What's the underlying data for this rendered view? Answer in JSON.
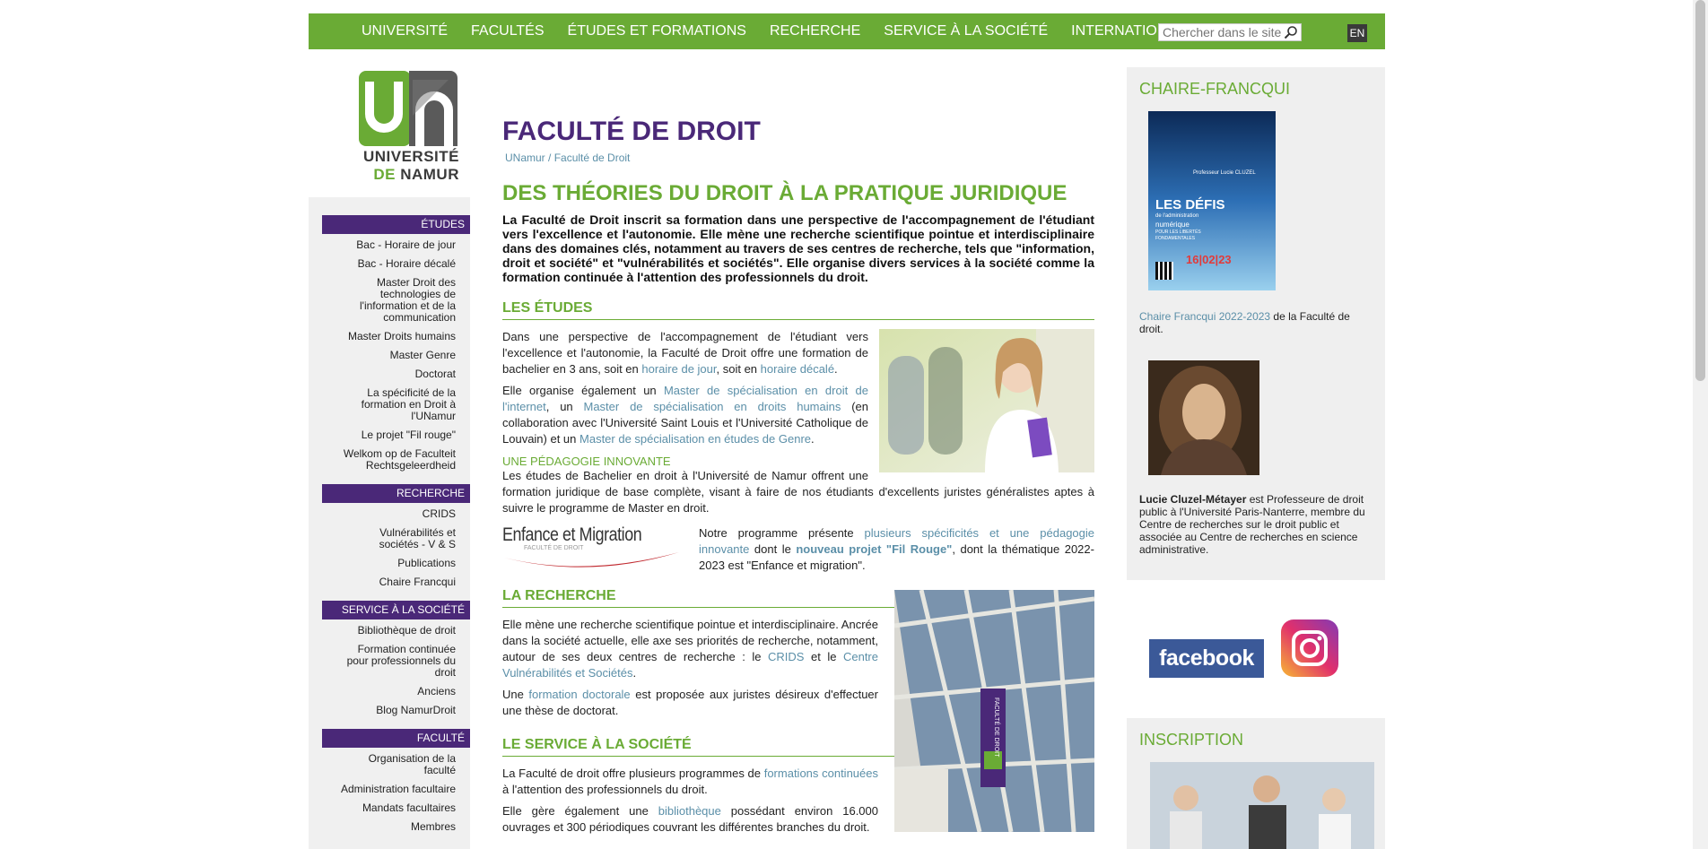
{
  "nav": {
    "items": [
      "UNIVERSITÉ",
      "FACULTÉS",
      "ÉTUDES ET FORMATIONS",
      "RECHERCHE",
      "SERVICE À LA SOCIÉTÉ",
      "INTERNATIONAL"
    ],
    "search_placeholder": "Chercher dans le site",
    "lang": "EN"
  },
  "logo": {
    "line1": "UNIVERSITÉ",
    "line2a": "DE",
    "line2b": "NAMUR"
  },
  "sidebar": {
    "etudes": {
      "title": "ÉTUDES",
      "items": [
        "Bac - Horaire de jour",
        "Bac - Horaire décalé",
        "Master Droit des technologies de l'information et de la communication",
        "Master Droits humains",
        "Master Genre",
        "Doctorat",
        "La spécificité de la formation en Droit à l'UNamur",
        "Le projet \"Fil rouge\"",
        "Welkom op de Faculteit Rechtsgeleerdheid"
      ]
    },
    "recherche": {
      "title": "RECHERCHE",
      "items": [
        "CRIDS",
        "Vulnérabilités et sociétés - V & S",
        "Publications",
        "Chaire Francqui"
      ]
    },
    "service": {
      "title": "SERVICE À LA SOCIÉTÉ",
      "items": [
        "Bibliothèque de droit",
        "Formation continuée pour professionnels du droit",
        "Anciens",
        "Blog NamurDroit"
      ]
    },
    "faculte": {
      "title": "FACULTÉ",
      "items": [
        "Organisation de la faculté",
        "Administration facultaire",
        "Mandats facultaires",
        "Membres"
      ]
    }
  },
  "main": {
    "title": "FACULTÉ DE DROIT",
    "breadcrumb": {
      "home": "UNamur",
      "sep": " / ",
      "current": "Faculté de Droit"
    },
    "headline": "DES THÉORIES DU DROIT À LA PRATIQUE JURIDIQUE",
    "intro": "La Faculté de Droit inscrit sa formation dans une perspective de l'accompagnement de l'étudiant vers l'excellence et l'autonomie. Elle mène une recherche scientifique pointue et interdisciplinaire dans des domaines clés, notamment au travers de ses centres de recherche, tels que \"information, droit et société\" et \"vulnérabilités et sociétés\". Elle organise divers services à la société comme la formation continuée à l'attention des professionnels du droit.",
    "etudes": {
      "title": "LES ÉTUDES",
      "p1a": "Dans une perspective de l'accompagnement de l'étudiant vers l'excellence et l'autonomie, la Faculté de Droit offre une formation de bachelier en 3 ans, soit en ",
      "p1_link1": "horaire de jour",
      "p1b": ", soit en ",
      "p1_link2": "horaire décalé",
      "p1c": ".",
      "p2a": "Elle organise également un ",
      "p2_link1": "Master de spécialisation en droit de l'internet",
      "p2b": ", un ",
      "p2_link2": "Master de spécialisation en droits humains",
      "p2c": " (en collaboration avec l'Université Saint Louis et l'Université Catholique de Louvain) et un ",
      "p2_link3": "Master de spécialisation en études de Genre",
      "p2d": ".",
      "sub": "UNE PÉDAGOGIE INNOVANTE",
      "p3": "Les études de Bachelier en droit à l'Université de Namur offrent une formation juridique de base complète, visant à faire de nos étudiants d'excellents juristes généralistes aptes à suivre le programme de Master en droit.",
      "em_logo": "Enfance et Migration",
      "em_sub": "FACULTÉ DE DROIT",
      "p4a": "Notre programme présente ",
      "p4_link1": "plusieurs spécificités et une pédagogie innovante",
      "p4b": " dont le ",
      "p4_link2": "nouveau projet \"Fil Rouge\"",
      "p4c": ", dont la thématique 2022-2023 est \"Enfance et migration\"."
    },
    "recherche": {
      "title": "LA RECHERCHE",
      "p1a": "Elle mène une recherche scientifique pointue et interdisciplinaire. Ancrée dans la société actuelle, elle axe ses priorités de recherche, notamment, autour de ses deux centres de recherche : le ",
      "p1_link1": "CRIDS",
      "p1b": " et le ",
      "p1_link2": "Centre Vulnérabilités et Sociétés",
      "p1c": ".",
      "p2a": "Une ",
      "p2_link": "formation doctorale",
      "p2b": " est proposée aux juristes désireux d'effectuer une thèse de doctorat.",
      "banner": "FACULTÉ DE DROIT"
    },
    "service": {
      "title": "LE SERVICE À LA SOCIÉTÉ",
      "p1a": "La Faculté de droit offre plusieurs programmes de ",
      "p1_link": "formations continuées",
      "p1b": " à l'attention des professionnels du droit.",
      "p2a": "Elle gère également une ",
      "p2_link": "bibliothèque",
      "p2b": " possédant environ 16.000 ouvrages et 300 périodiques couvrant les différentes branches du droit."
    }
  },
  "right": {
    "chaire_title": "CHAIRE-FRANCQUI",
    "poster": {
      "title1": "LES DÉFIS",
      "title2": "de l'administration",
      "title3": "numérique",
      "title4": "POUR LES LIBERTÉS",
      "title5": "FONDAMENTALES",
      "date": "16|02|23",
      "speaker": "Professeur Lucie CLUZEL"
    },
    "chaire_link": "Chaire Francqui 2022-2023",
    "chaire_text": " de la Faculté de droit.",
    "person_name": "Lucie Cluzel-Métayer",
    "person_text": " est Professeure de droit public à l'Université Paris-Nanterre, membre du Centre de recherches sur le droit public et associée au Centre de recherches en science administrative.",
    "facebook": "facebook",
    "inscription_title": "INSCRIPTION"
  },
  "colors": {
    "green": "#6aab35",
    "purple": "#4a2878",
    "link": "#5b8fa8"
  }
}
